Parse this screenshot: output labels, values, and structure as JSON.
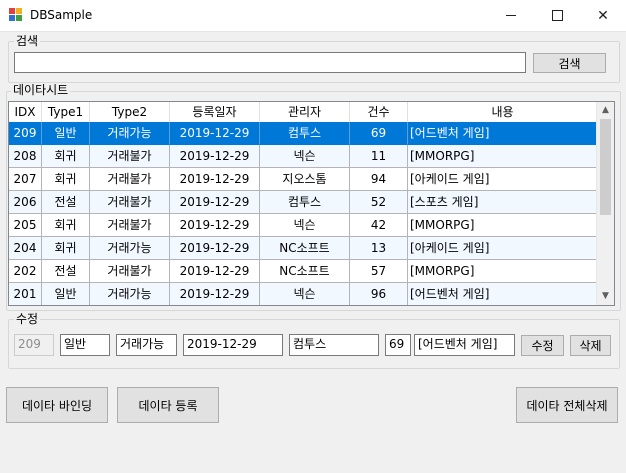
{
  "window": {
    "title": "DBSample",
    "minimize": "",
    "maximize": "",
    "close": "✕"
  },
  "search": {
    "group_label": "검색",
    "input_value": "",
    "button_label": "검색"
  },
  "datasheet": {
    "group_label": "데이타시트",
    "columns": [
      "IDX",
      "Type1",
      "Type2",
      "등록일자",
      "관리자",
      "건수",
      "내용"
    ],
    "rows": [
      [
        "209",
        "일반",
        "거래가능",
        "2019-12-29",
        "컴투스",
        "69",
        "[어드벤처 게임]"
      ],
      [
        "208",
        "회귀",
        "거래불가",
        "2019-12-29",
        "넥슨",
        "11",
        "[MMORPG]"
      ],
      [
        "207",
        "회귀",
        "거래불가",
        "2019-12-29",
        "지오스톰",
        "94",
        "[아케이드 게임]"
      ],
      [
        "206",
        "전설",
        "거래불가",
        "2019-12-29",
        "컴투스",
        "52",
        "[스포츠 게임]"
      ],
      [
        "205",
        "회귀",
        "거래불가",
        "2019-12-29",
        "넥슨",
        "42",
        "[MMORPG]"
      ],
      [
        "204",
        "회귀",
        "거래가능",
        "2019-12-29",
        "NC소프트",
        "13",
        "[아케이드 게임]"
      ],
      [
        "202",
        "전설",
        "거래불가",
        "2019-12-29",
        "NC소프트",
        "57",
        "[MMORPG]"
      ],
      [
        "201",
        "일반",
        "거래가능",
        "2019-12-29",
        "넥슨",
        "96",
        "[어드벤처 게임]"
      ]
    ],
    "selected_row": 0,
    "scroll_up": "▲",
    "scroll_down": "▼"
  },
  "edit": {
    "group_label": "수정",
    "idx": "209",
    "type1": "일반",
    "type2": "거래가능",
    "date": "2019-12-29",
    "manager": "컴투스",
    "count": "69",
    "content": "[어드벤처 게임]",
    "update_label": "수정",
    "delete_label": "삭제"
  },
  "actions": {
    "bind_label": "데이타 바인딩",
    "register_label": "데이타 등록",
    "delete_all_label": "데이타 전체삭제"
  },
  "colors": {
    "selection": "#0078d7",
    "alt_row": "#f2f8ff"
  }
}
